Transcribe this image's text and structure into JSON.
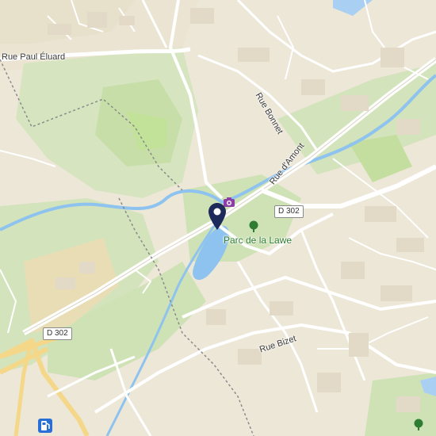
{
  "map": {
    "streets": {
      "rue_paul_eluard": "Rue Paul Éluard",
      "rue_bonnet": "Rue Bonnet",
      "rue_d_amont": "Rue d'Amont",
      "rue_bizet": "Rue Bizet"
    },
    "route_shields": {
      "d302_east": "D 302",
      "d302_west": "D 302"
    },
    "places": {
      "park": "Parc de la Lawe"
    },
    "icons": {
      "marker": "location-pin-icon",
      "photo": "camera-icon",
      "park": "tree-icon",
      "fuel": "fuel-pump-icon",
      "park_se": "tree-icon"
    },
    "colors": {
      "land": "#ede7d8",
      "green": "#cfe2b5",
      "water": "#8ec3ef",
      "road": "#ffffff",
      "marker": "#1e2a5a",
      "photo_poi": "#8b3fa6",
      "park_poi": "#2f7d32"
    }
  }
}
